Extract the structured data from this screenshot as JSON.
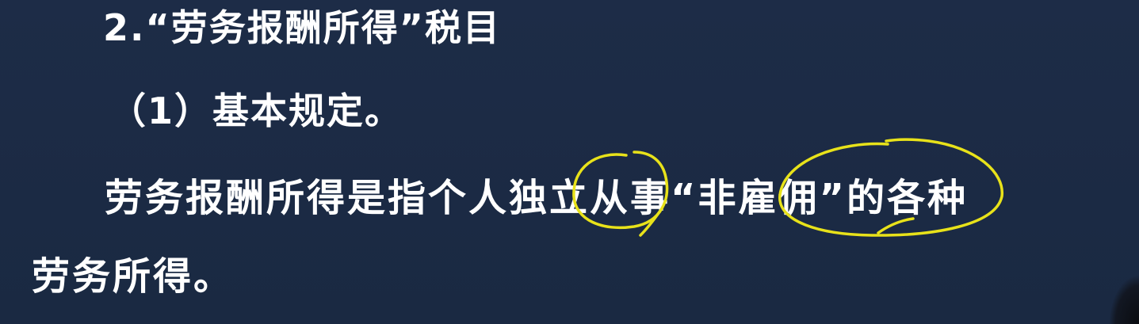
{
  "slide": {
    "heading_section": "2.“劳务报酬所得”税目",
    "heading_sub": "（1）基本规定。",
    "paragraph_line_1": "劳务报酬所得是指个人独立从事“非雇佣”的各种",
    "paragraph_line_2": "劳务所得。"
  },
  "colors": {
    "background": "#1b2a44",
    "text": "#ffffff",
    "annotation": "#e8e21a"
  }
}
